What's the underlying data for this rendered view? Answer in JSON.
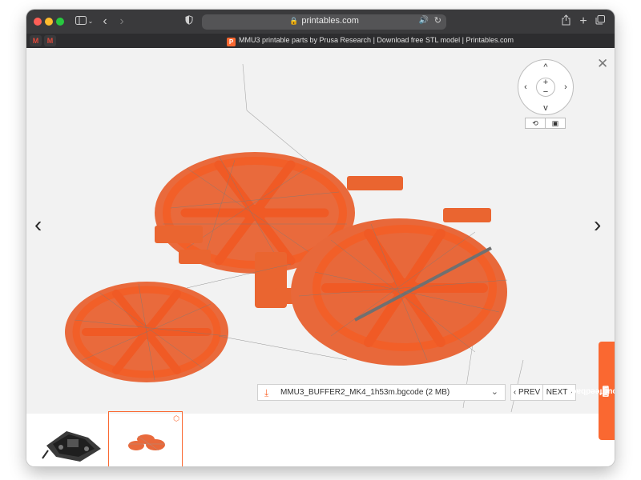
{
  "browser": {
    "url": "printables.com",
    "tab_title": "MMU3 printable parts by Prusa Research | Download free STL model | Printables.com",
    "pinned_tabs": [
      "M",
      "M"
    ],
    "icons": {
      "sidebar": "sidebar-icon",
      "back": "back-arrow-icon",
      "forward": "forward-arrow-icon",
      "shield": "shield-icon",
      "lock": "lock-icon",
      "reload": "reload-icon",
      "share": "share-icon",
      "new_tab": "plus-icon",
      "tabs_overview": "tabs-icon"
    }
  },
  "viewer": {
    "controls": {
      "zoom_in": "+",
      "zoom_out": "−"
    },
    "file": {
      "name": "MMU3_BUFFER2_MK4_1h53m.bgcode (2 MB)"
    },
    "pager": {
      "prev": "PREV",
      "next": "NEXT"
    },
    "accent_color": "#fa6831"
  },
  "feedback": {
    "label": "Share your feedback"
  }
}
